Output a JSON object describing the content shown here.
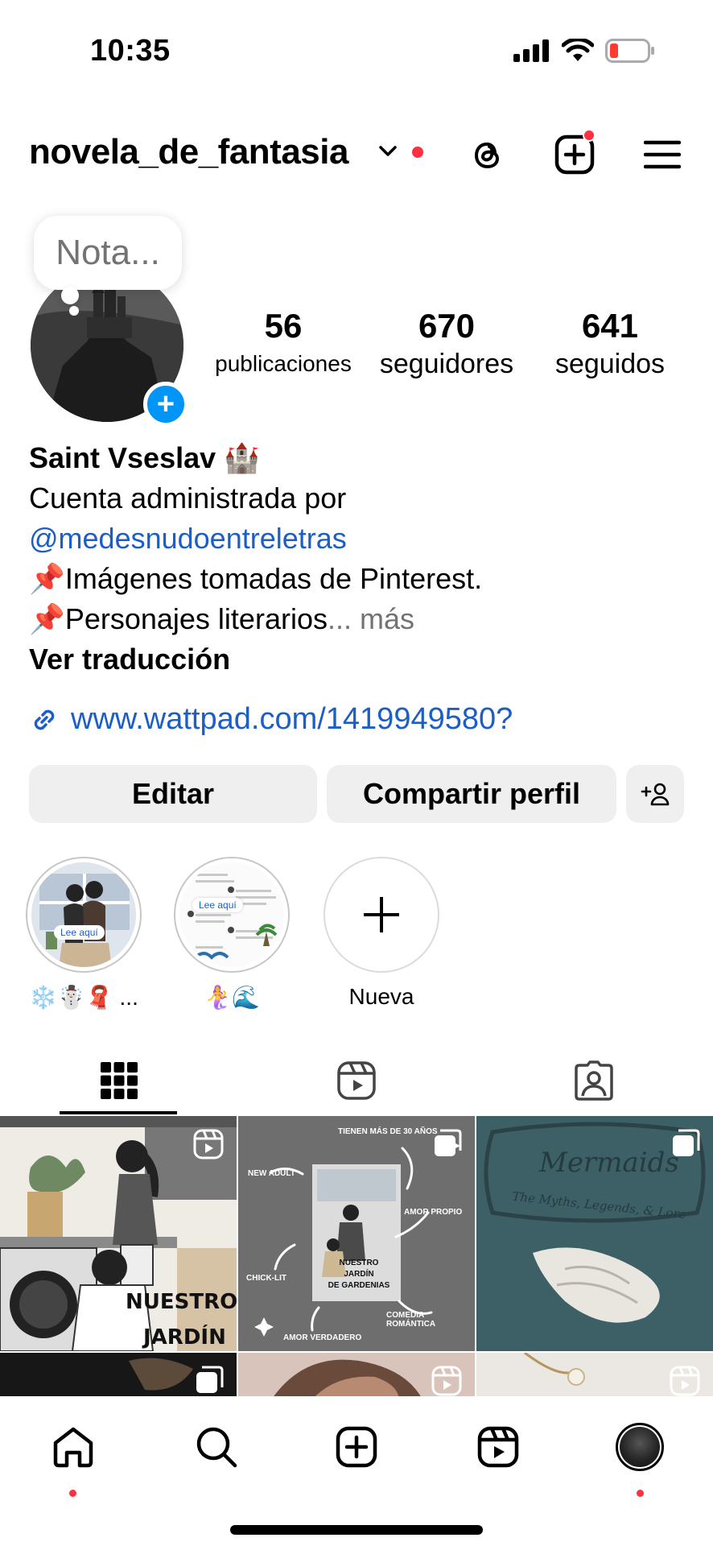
{
  "status_bar": {
    "time": "10:35"
  },
  "header": {
    "username": "novela_de_fantasia"
  },
  "note": {
    "placeholder": "Nota..."
  },
  "stats": [
    {
      "value": "56",
      "label": "publicaciones"
    },
    {
      "value": "670",
      "label": "seguidores"
    },
    {
      "value": "641",
      "label": "seguidos"
    }
  ],
  "bio": {
    "name": "Saint Vseslav 🏰",
    "line1": "Cuenta administrada por",
    "mention": "@medesnudoentreletras",
    "line2": "📌Imágenes tomadas de Pinterest.",
    "line3": "📌Personajes literarios",
    "ellipsis": "...",
    "more": "más",
    "translate": "Ver traducción",
    "website": "www.wattpad.com/1419949580?"
  },
  "buttons": {
    "edit": "Editar",
    "share": "Compartir perfil"
  },
  "highlights": [
    {
      "label": "❄️☃️🧣 ...",
      "inner_text": "Lee aquí"
    },
    {
      "label": "🧜‍♀️🌊",
      "inner_text": "Lee aquí"
    },
    {
      "label": "Nueva"
    }
  ],
  "posts": [
    {
      "text_1": "NUESTRO",
      "text_2": "JARDÍN"
    },
    {
      "title_tags": [
        "TIENEN MÁS DE 30 AÑOS",
        "NEW ADULT",
        "AMOR PROPIO",
        "CHICK-LIT",
        "COMEDIA ROMÁNTICA",
        "AMOR VERDADERO"
      ],
      "center": [
        "NUESTRO",
        "JARDÍN",
        "DE GARDENIAS"
      ]
    },
    {
      "title": "Mermaids",
      "subtitle": "The Myths, Legends, & Lore"
    }
  ]
}
